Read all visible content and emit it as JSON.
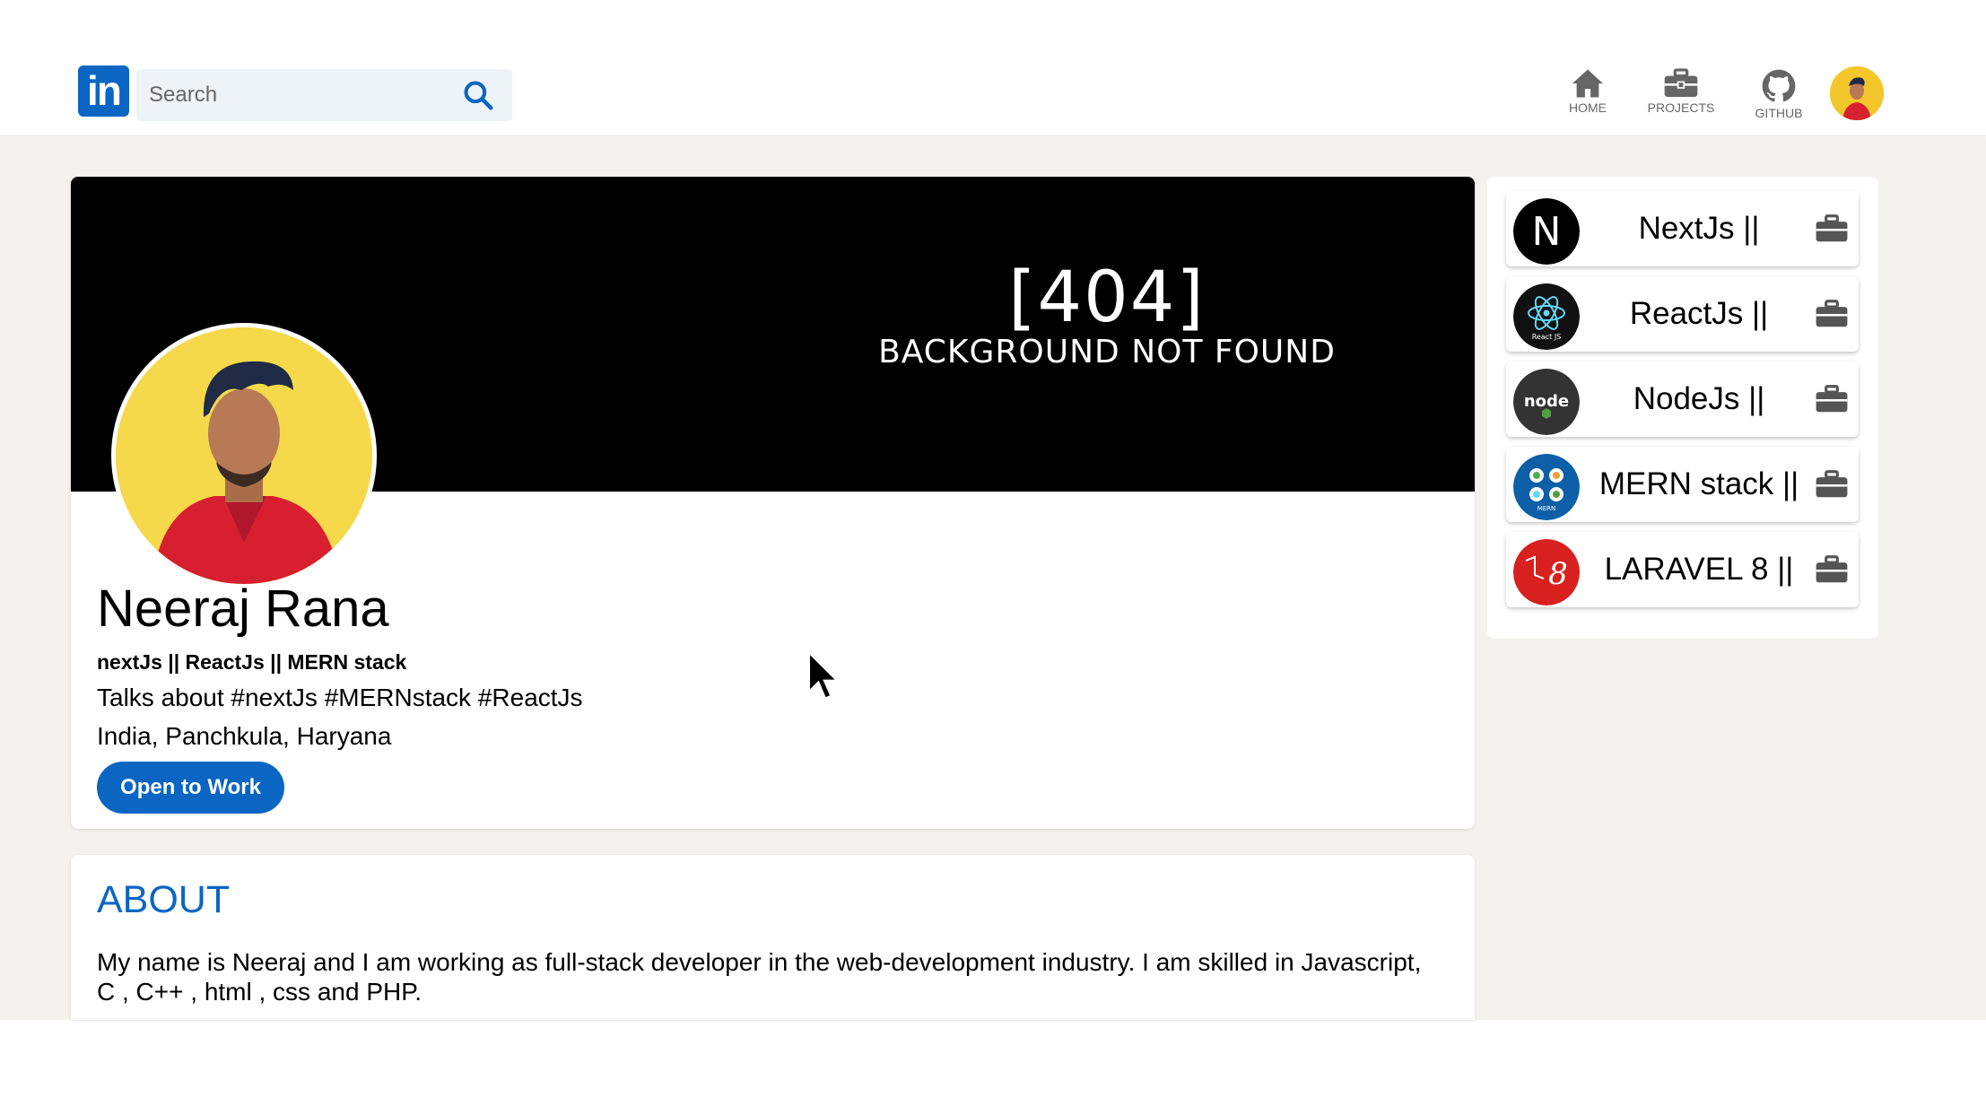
{
  "header": {
    "logo_text": "in",
    "search_placeholder": "Search",
    "nav": [
      {
        "label": "HOME",
        "icon": "home-icon"
      },
      {
        "label": "PROJECTS",
        "icon": "briefcase-icon"
      },
      {
        "label": "GITHUB",
        "icon": "github-icon"
      }
    ]
  },
  "profile": {
    "banner_code": "[404]",
    "banner_message": "BACKGROUND NOT FOUND",
    "name": "Neeraj Rana",
    "headline": "nextJs || ReactJs || MERN stack",
    "talks": "Talks about #nextJs #MERNstack #ReactJs",
    "location": "India, Panchkula, Haryana",
    "open_to_work": "Open to Work"
  },
  "about": {
    "title": "ABOUT",
    "text": "My name is Neeraj and I am working as full-stack developer in the web-development industry. I am skilled in Javascript, C , C++ , html , css and PHP."
  },
  "skills": [
    {
      "label": "NextJs ||",
      "logo": "nextjs-logo-icon",
      "logo_text": "N"
    },
    {
      "label": "ReactJs ||",
      "logo": "react-logo-icon",
      "logo_text": "React JS"
    },
    {
      "label": "NodeJs ||",
      "logo": "node-logo-icon",
      "logo_text": "node"
    },
    {
      "label": "MERN stack ||",
      "logo": "mern-logo-icon",
      "logo_text": "MERN"
    },
    {
      "label": "LARAVEL 8 ||",
      "logo": "laravel-logo-icon",
      "logo_text": "8"
    }
  ],
  "colors": {
    "brand_blue": "#0a66c2",
    "page_bg": "#f4f2ee",
    "banner_bg": "#000000"
  }
}
